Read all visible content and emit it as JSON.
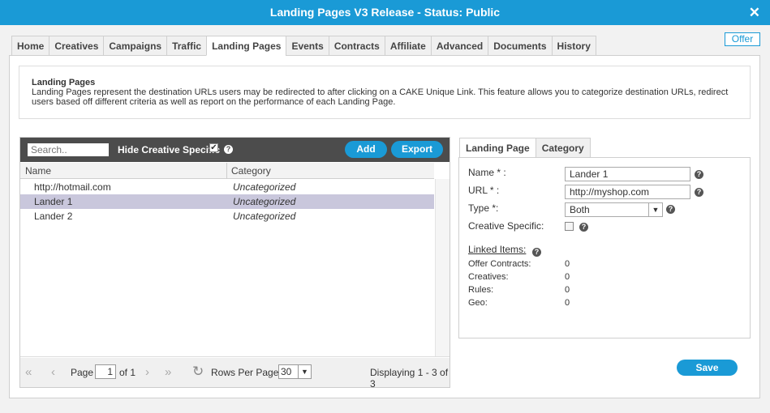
{
  "window": {
    "title": "Landing Pages V3 Release - Status: Public",
    "close_glyph": "✕"
  },
  "offer_button": "Offer",
  "tabs": [
    {
      "label": "Home"
    },
    {
      "label": "Creatives"
    },
    {
      "label": "Campaigns"
    },
    {
      "label": "Traffic"
    },
    {
      "label": "Landing Pages",
      "active": true
    },
    {
      "label": "Events"
    },
    {
      "label": "Contracts"
    },
    {
      "label": "Affiliate"
    },
    {
      "label": "Advanced"
    },
    {
      "label": "Documents"
    },
    {
      "label": "History"
    }
  ],
  "info": {
    "heading": "Landing Pages",
    "description": "Landing Pages represent the destination URLs users may be redirected to after clicking on a CAKE Unique Link. This feature allows you to categorize destination URLs, redirect users based off different criteria as well as report on the performance of each Landing Page."
  },
  "grid": {
    "search_placeholder": "Search..",
    "hide_creative_label": "Hide Creative Specific",
    "hide_creative_checked": true,
    "add_label": "Add",
    "export_label": "Export",
    "columns": {
      "name": "Name",
      "category": "Category"
    },
    "rows": [
      {
        "name": "http://hotmail.com",
        "category": "Uncategorized"
      },
      {
        "name": "Lander 1",
        "category": "Uncategorized",
        "selected": true
      },
      {
        "name": "Lander 2",
        "category": "Uncategorized"
      }
    ],
    "pager": {
      "page_label": "Page",
      "page_value": "1",
      "of_label": "of 1",
      "rows_per_page_label": "Rows Per Page:",
      "rows_per_page_value": "30",
      "displaying": "Displaying 1 - 3 of 3"
    }
  },
  "detail": {
    "tabs": [
      {
        "label": "Landing Page",
        "active": true
      },
      {
        "label": "Category"
      }
    ],
    "name_label": "Name * :",
    "name_value": "Lander 1",
    "url_label": "URL * :",
    "url_value": "http://myshop.com",
    "type_label": "Type *:",
    "type_value": "Both",
    "creative_specific_label": "Creative Specific:",
    "creative_specific_checked": false,
    "linked_items_label": "Linked Items:",
    "linked": [
      {
        "label": "Offer Contracts:",
        "value": "0"
      },
      {
        "label": "Creatives:",
        "value": "0"
      },
      {
        "label": "Rules:",
        "value": "0"
      },
      {
        "label": "Geo:",
        "value": "0"
      }
    ],
    "save_label": "Save"
  },
  "icons": {
    "help": "?",
    "first": "«",
    "prev": "‹",
    "next": "›",
    "last": "»",
    "refresh": "↻",
    "dropdown": "▼",
    "check": "✔"
  },
  "colors": {
    "accent": "#1a9ad6",
    "toolbar": "#4c4c4c",
    "selected_row": "#c9c7dc"
  }
}
